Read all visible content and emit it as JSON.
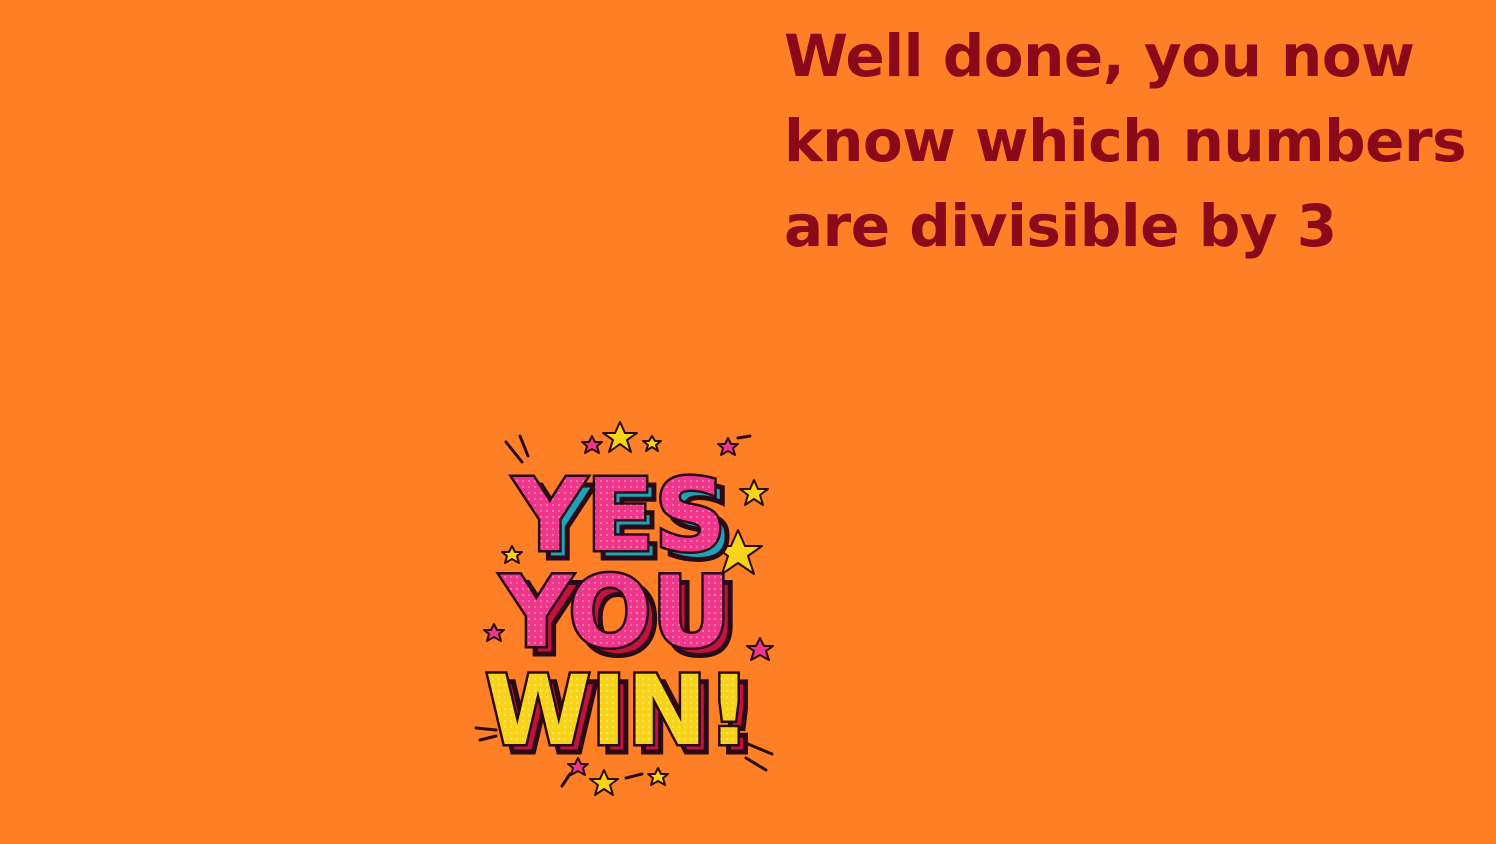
{
  "message": {
    "text": "Well done, you now know which numbers are divisible by 3"
  },
  "badge": {
    "line1": "YES",
    "line2": "YOU",
    "line3": "WIN!",
    "icon": "yes-you-win-sticker"
  },
  "colors": {
    "background": "#FF7F27",
    "message_text": "#8B0A1A",
    "pink": "#F0368A",
    "yellow": "#F7D31A",
    "outline": "#2A0A14",
    "shadow_red": "#C2123F",
    "shadow_teal": "#1FA3B8"
  }
}
